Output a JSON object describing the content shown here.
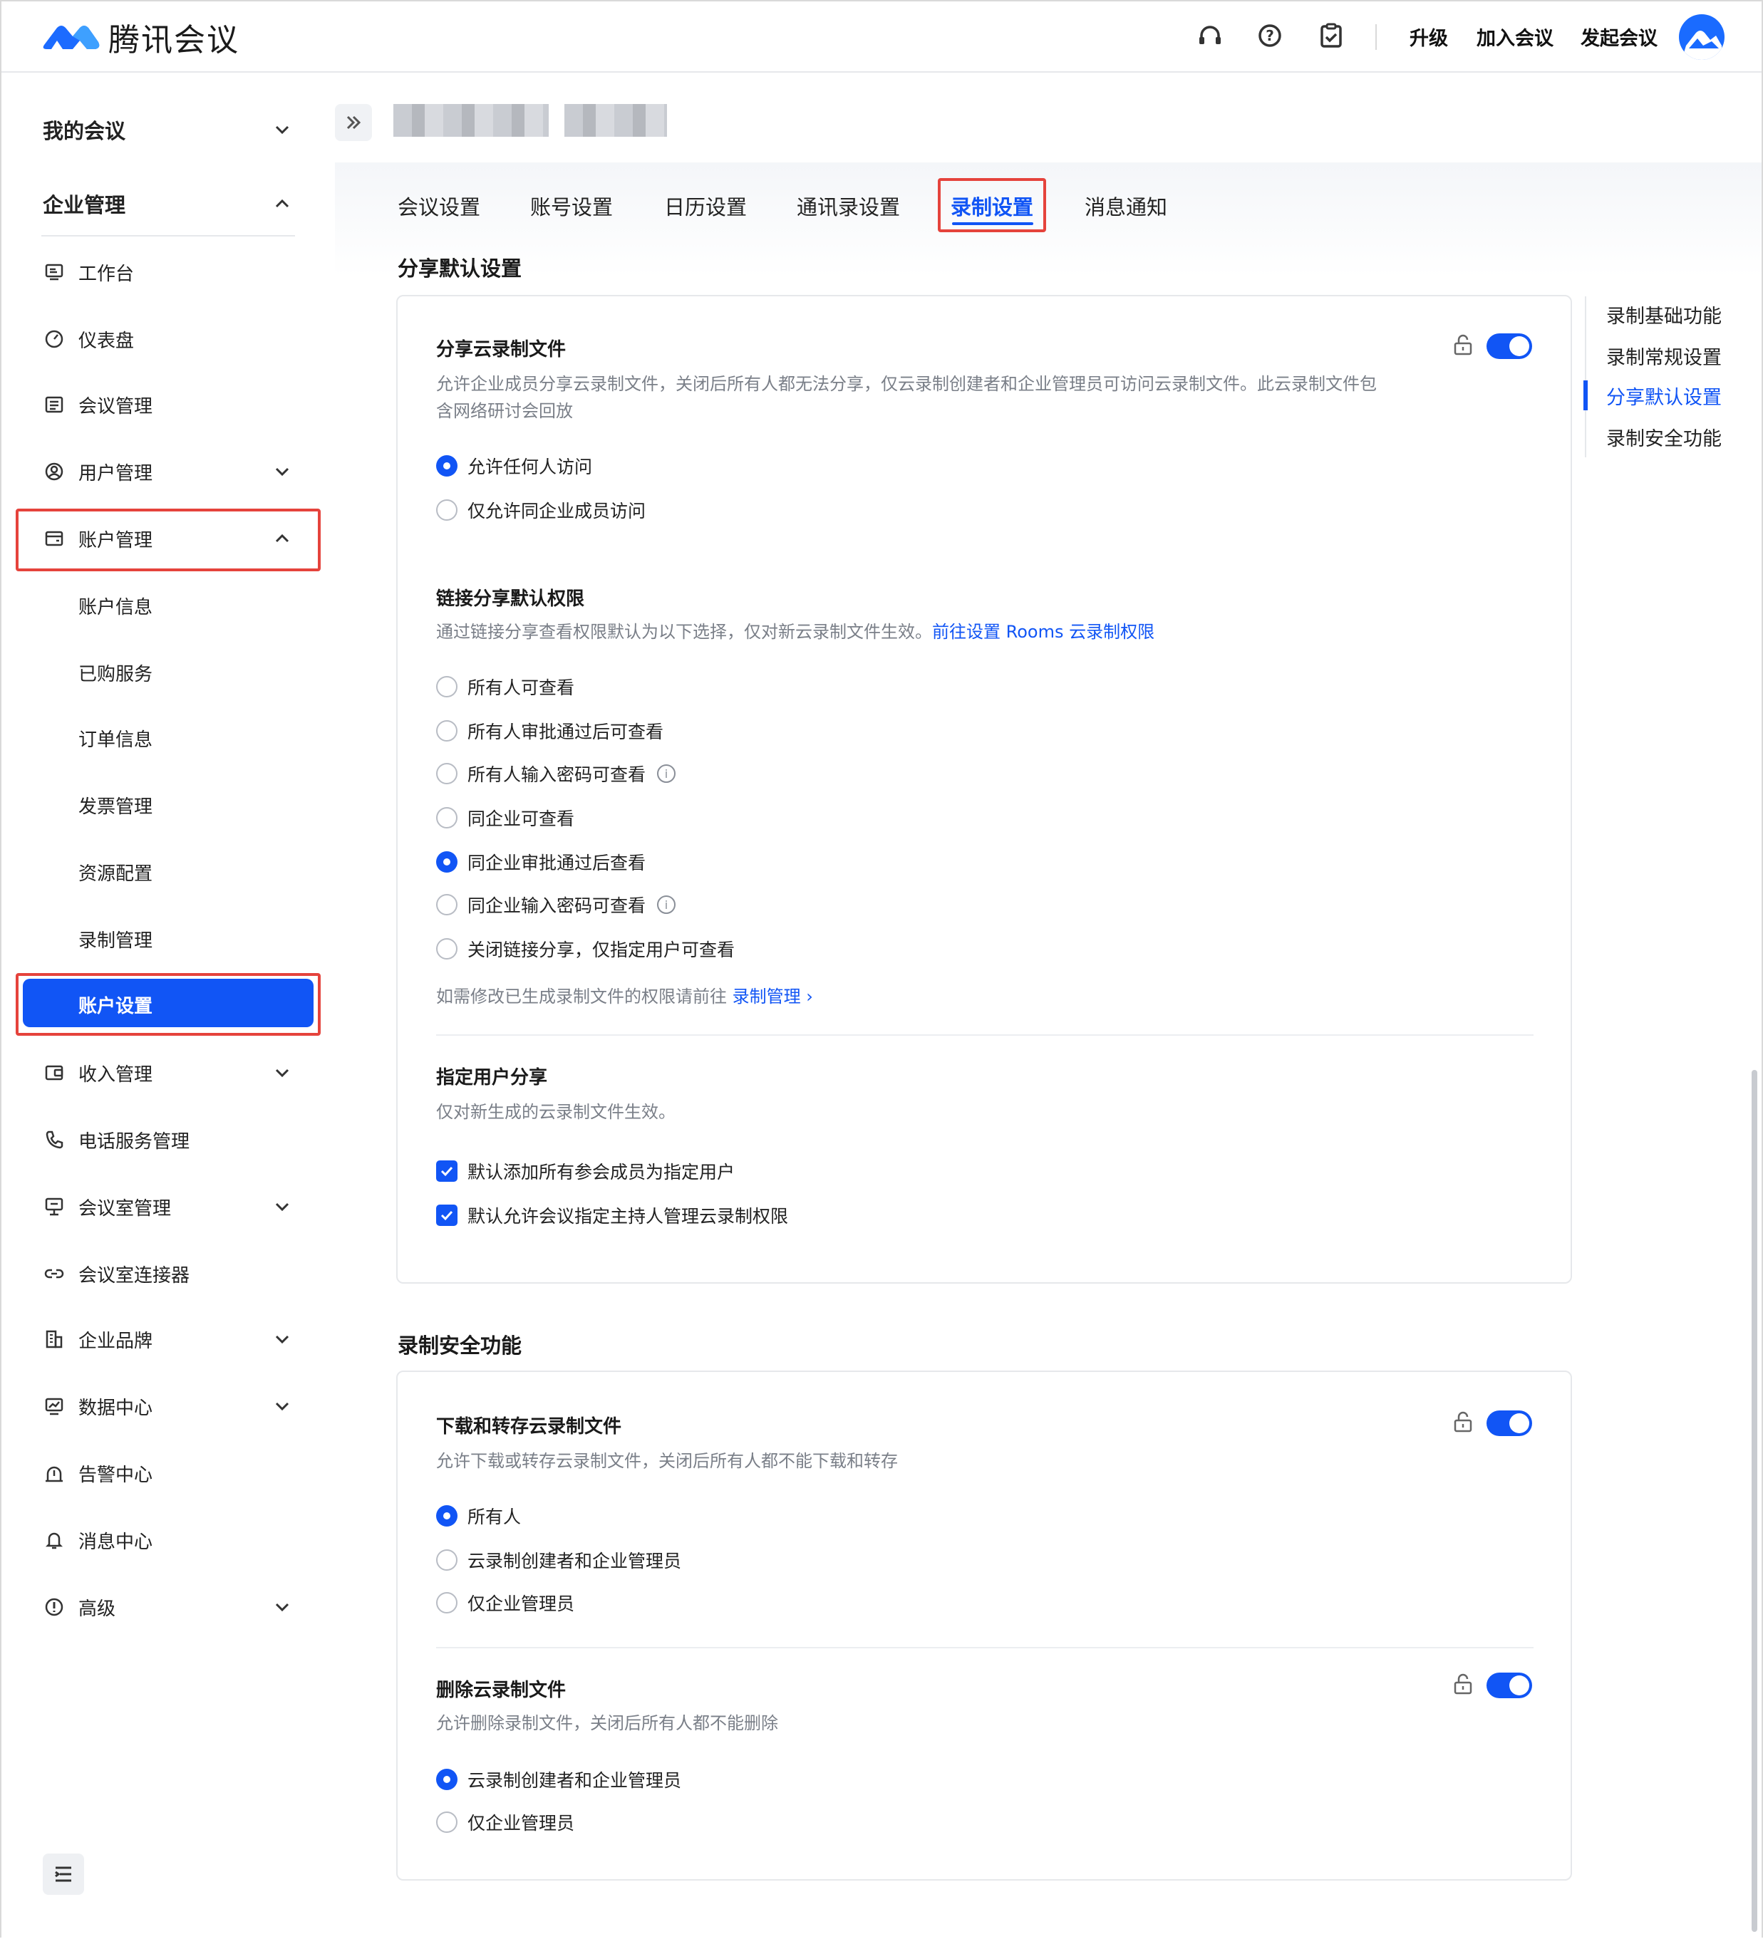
{
  "header": {
    "app_name": "腾讯会议",
    "links": [
      "升级",
      "加入会议",
      "发起会议"
    ],
    "icons": [
      "headset-icon",
      "help-icon",
      "clipboard-check-icon"
    ]
  },
  "sidebar": {
    "my_meetings": "我的会议",
    "enterprise": "企业管理",
    "items": [
      {
        "label": "工作台",
        "icon": "desktop-icon"
      },
      {
        "label": "仪表盘",
        "icon": "gauge-icon"
      },
      {
        "label": "会议管理",
        "icon": "list-icon"
      },
      {
        "label": "用户管理",
        "icon": "user-circle-icon"
      },
      {
        "label": "账户管理",
        "icon": "wallet-icon"
      },
      {
        "label": "账户信息"
      },
      {
        "label": "已购服务"
      },
      {
        "label": "订单信息"
      },
      {
        "label": "发票管理"
      },
      {
        "label": "资源配置"
      },
      {
        "label": "录制管理"
      },
      {
        "label": "账户设置"
      },
      {
        "label": "收入管理",
        "icon": "income-icon"
      },
      {
        "label": "电话服务管理",
        "icon": "phone-icon"
      },
      {
        "label": "会议室管理",
        "icon": "room-icon"
      },
      {
        "label": "会议室连接器",
        "icon": "link-icon"
      },
      {
        "label": "企业品牌",
        "icon": "building-icon"
      },
      {
        "label": "数据中心",
        "icon": "chart-icon"
      },
      {
        "label": "告警中心",
        "icon": "alarm-icon"
      },
      {
        "label": "消息中心",
        "icon": "bell-icon"
      },
      {
        "label": "高级",
        "icon": "advanced-icon"
      }
    ]
  },
  "tabs": [
    "会议设置",
    "账号设置",
    "日历设置",
    "通讯录设置",
    "录制设置",
    "消息通知"
  ],
  "active_tab": "录制设置",
  "anchors": [
    "录制基础功能",
    "录制常规设置",
    "分享默认设置",
    "录制安全功能"
  ],
  "share_section": {
    "title": "分享默认设置",
    "share_cloud": {
      "title": "分享云录制文件",
      "desc": "允许企业成员分享云录制文件，关闭后所有人都无法分享，仅云录制创建者和企业管理员可访问云录制文件。此云录制文件包含网络研讨会回放",
      "options": [
        "允许任何人访问",
        "仅允许同企业成员访问"
      ],
      "selected": 0,
      "enabled": true
    },
    "link_perm": {
      "title": "链接分享默认权限",
      "desc": "通过链接分享查看权限默认为以下选择，仅对新云录制文件生效。",
      "desc_link": "前往设置 Rooms 云录制权限",
      "options": [
        "所有人可查看",
        "所有人审批通过后可查看",
        "所有人输入密码可查看",
        "同企业可查看",
        "同企业审批通过后查看",
        "同企业输入密码可查看",
        "关闭链接分享，仅指定用户可查看"
      ],
      "selected": 4,
      "footer": "如需修改已生成录制文件的权限请前往",
      "footer_link": "录制管理"
    },
    "designated": {
      "title": "指定用户分享",
      "desc": "仅对新生成的云录制文件生效。",
      "checks": [
        "默认添加所有参会成员为指定用户",
        "默认允许会议指定主持人管理云录制权限"
      ]
    }
  },
  "security_section": {
    "title": "录制安全功能",
    "download": {
      "title": "下载和转存云录制文件",
      "desc": "允许下载或转存云录制文件，关闭后所有人都不能下载和转存",
      "options": [
        "所有人",
        "云录制创建者和企业管理员",
        "仅企业管理员"
      ],
      "selected": 0,
      "enabled": true
    },
    "delete": {
      "title": "删除云录制文件",
      "desc": "允许删除录制文件，关闭后所有人都不能删除",
      "options": [
        "云录制创建者和企业管理员",
        "仅企业管理员"
      ],
      "selected": 0,
      "enabled": true
    }
  },
  "colors": {
    "accent": "#1155f5",
    "highlight": "#e5433c"
  }
}
